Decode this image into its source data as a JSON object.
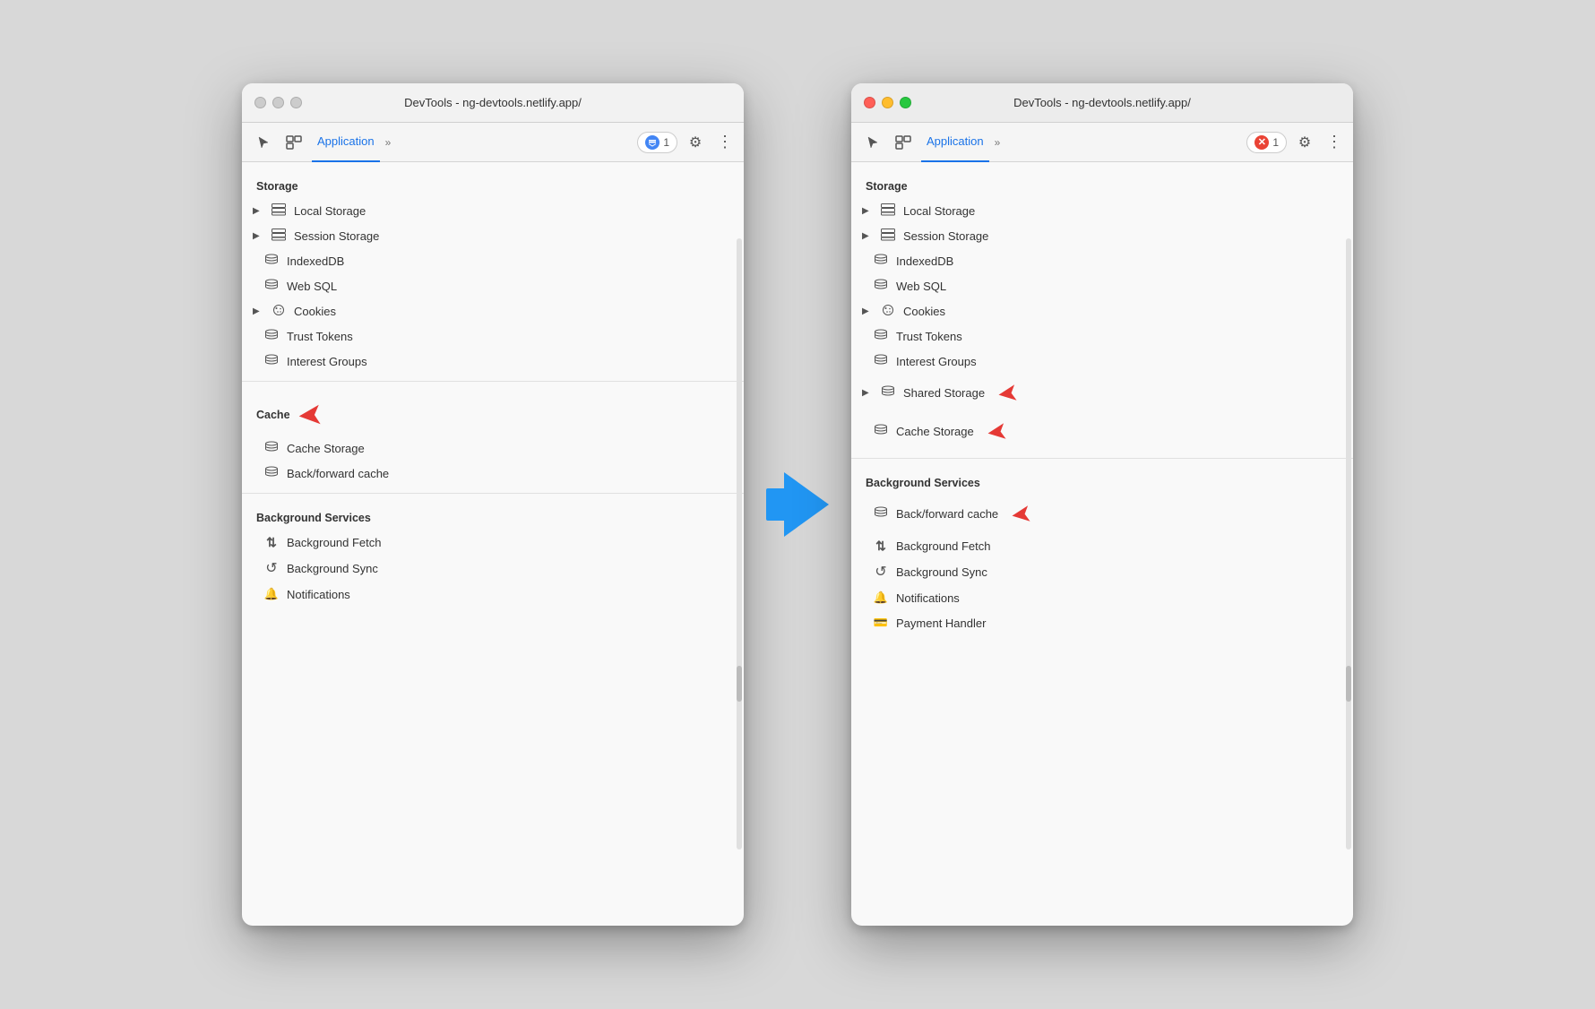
{
  "scene": {
    "background": "#d8d8d8"
  },
  "left_window": {
    "titlebar": {
      "title": "DevTools - ng-devtools.netlify.app/",
      "active": false
    },
    "toolbar": {
      "tab_label": "Application",
      "badge_count": "1",
      "badge_type": "blue"
    },
    "storage_section": {
      "header": "Storage",
      "items": [
        {
          "label": "Local Storage",
          "icon": "grid",
          "expandable": true
        },
        {
          "label": "Session Storage",
          "icon": "grid",
          "expandable": true
        },
        {
          "label": "IndexedDB",
          "icon": "db"
        },
        {
          "label": "Web SQL",
          "icon": "db"
        },
        {
          "label": "Cookies",
          "icon": "cookie",
          "expandable": true
        },
        {
          "label": "Trust Tokens",
          "icon": "db"
        },
        {
          "label": "Interest Groups",
          "icon": "db"
        }
      ]
    },
    "cache_section": {
      "header": "Cache",
      "has_red_arrow": true,
      "items": [
        {
          "label": "Cache Storage",
          "icon": "db"
        },
        {
          "label": "Back/forward cache",
          "icon": "db"
        }
      ]
    },
    "background_section": {
      "header": "Background Services",
      "items": [
        {
          "label": "Background Fetch",
          "icon": "fetch"
        },
        {
          "label": "Background Sync",
          "icon": "sync"
        },
        {
          "label": "Notifications",
          "icon": "bell"
        }
      ]
    }
  },
  "right_window": {
    "titlebar": {
      "title": "DevTools - ng-devtools.netlify.app/",
      "active": true
    },
    "toolbar": {
      "tab_label": "Application",
      "badge_count": "1",
      "badge_type": "red"
    },
    "storage_section": {
      "header": "Storage",
      "items": [
        {
          "label": "Local Storage",
          "icon": "grid",
          "expandable": true
        },
        {
          "label": "Session Storage",
          "icon": "grid",
          "expandable": true
        },
        {
          "label": "IndexedDB",
          "icon": "db"
        },
        {
          "label": "Web SQL",
          "icon": "db"
        },
        {
          "label": "Cookies",
          "icon": "cookie",
          "expandable": true
        },
        {
          "label": "Trust Tokens",
          "icon": "db"
        },
        {
          "label": "Interest Groups",
          "icon": "db",
          "has_red_arrow": false
        },
        {
          "label": "Shared Storage",
          "icon": "db",
          "expandable": true,
          "has_red_arrow": true
        },
        {
          "label": "Cache Storage",
          "icon": "db",
          "has_red_arrow": true
        }
      ]
    },
    "background_section": {
      "header": "Background Services",
      "items": [
        {
          "label": "Back/forward cache",
          "icon": "db",
          "has_red_arrow": true
        },
        {
          "label": "Background Fetch",
          "icon": "fetch"
        },
        {
          "label": "Background Sync",
          "icon": "sync"
        },
        {
          "label": "Notifications",
          "icon": "bell"
        },
        {
          "label": "Payment Handler",
          "icon": "card"
        }
      ]
    }
  },
  "icons": {
    "cursor": "⬡",
    "layers": "⧉",
    "chevron": "»",
    "gear": "⚙",
    "dots": "⋮",
    "db": "🗄",
    "grid": "▦",
    "cookie": "◉",
    "bell": "🔔",
    "sync": "↺",
    "fetch": "⇅",
    "card": "▬",
    "triangle_right": "▶",
    "chat": "💬"
  }
}
